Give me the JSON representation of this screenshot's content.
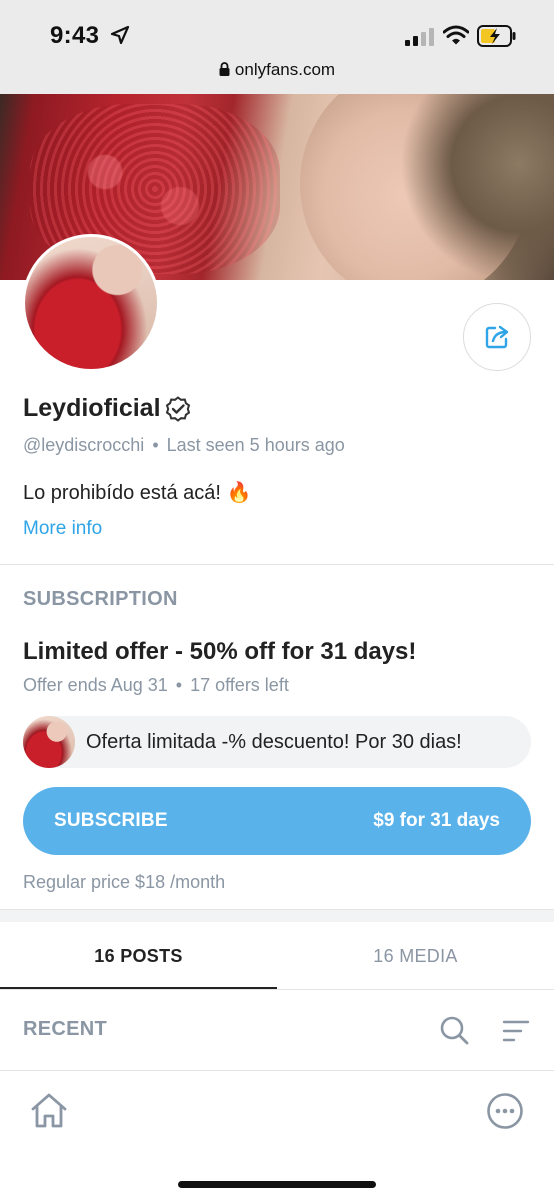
{
  "status_bar": {
    "time": "9:43",
    "icons": [
      "location-arrow-icon",
      "signal-icon",
      "wifi-icon",
      "battery-charging-icon"
    ]
  },
  "browser": {
    "url": "onlyfans.com",
    "lock_icon": "lock-icon"
  },
  "profile": {
    "display_name": "Leydioficial",
    "verified_icon": "verified-badge-icon",
    "handle": "@leydiscrocchi",
    "separator": "•",
    "last_seen": "Last seen 5 hours ago",
    "bio": "Lo prohibído está acá! 🔥",
    "more_info": "More info",
    "share_icon": "share-icon"
  },
  "subscription": {
    "heading": "SUBSCRIPTION",
    "offer_title": "Limited offer - 50% off for 31 days!",
    "offer_ends": "Offer ends Aug 31",
    "separator": "•",
    "offers_left": "17 offers left",
    "promo_message": "Oferta limitada -% descuento! Por 30 dias!",
    "subscribe_label": "SUBSCRIBE",
    "subscribe_price": "$9 for 31 days",
    "regular_price": "Regular price $18 /month"
  },
  "tabs": [
    {
      "label": "16 POSTS",
      "active": true
    },
    {
      "label": "16 MEDIA",
      "active": false
    }
  ],
  "feed": {
    "sort_label": "RECENT",
    "icons": [
      "search-icon",
      "sort-icon"
    ]
  },
  "bottom_nav": {
    "icons": [
      "home-icon",
      "more-options-icon"
    ]
  },
  "colors": {
    "accent": "#00aff0",
    "subscribe_bg": "#5ab2ea",
    "muted_text": "#8a96a3",
    "link": "#2fa4e7"
  }
}
